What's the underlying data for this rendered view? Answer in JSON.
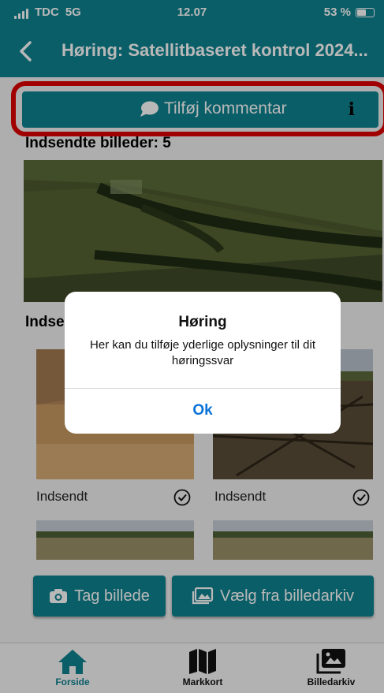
{
  "status_bar": {
    "carrier": "TDC",
    "network": "5G",
    "time": "12.07",
    "battery": "53 %"
  },
  "header": {
    "title": "Høring: Satellitbaseret kontrol 2024..."
  },
  "comment_button": {
    "label": "Tilføj kommentar",
    "info": "i"
  },
  "submitted_heading": "Indsendte billeder: 5",
  "section2_heading": "Indse",
  "photos": [
    {
      "caption": "Indsendt"
    },
    {
      "caption": "Indsendt"
    }
  ],
  "actions": {
    "take_photo": "Tag billede",
    "choose_archive": "Vælg fra billedarkiv"
  },
  "dialog": {
    "title": "Høring",
    "message": "Her kan du tilføje yderlige oplysninger til dit høringssvar",
    "ok": "Ok"
  },
  "tabs": [
    {
      "label": "Forside",
      "icon": "home-icon",
      "active": true
    },
    {
      "label": "Markkort",
      "icon": "map-icon",
      "active": false
    },
    {
      "label": "Billedarkiv",
      "icon": "photo-library-icon",
      "active": false
    }
  ],
  "colors": {
    "accent": "#0f8391",
    "highlight": "#e00000",
    "link": "#0a72d8"
  }
}
